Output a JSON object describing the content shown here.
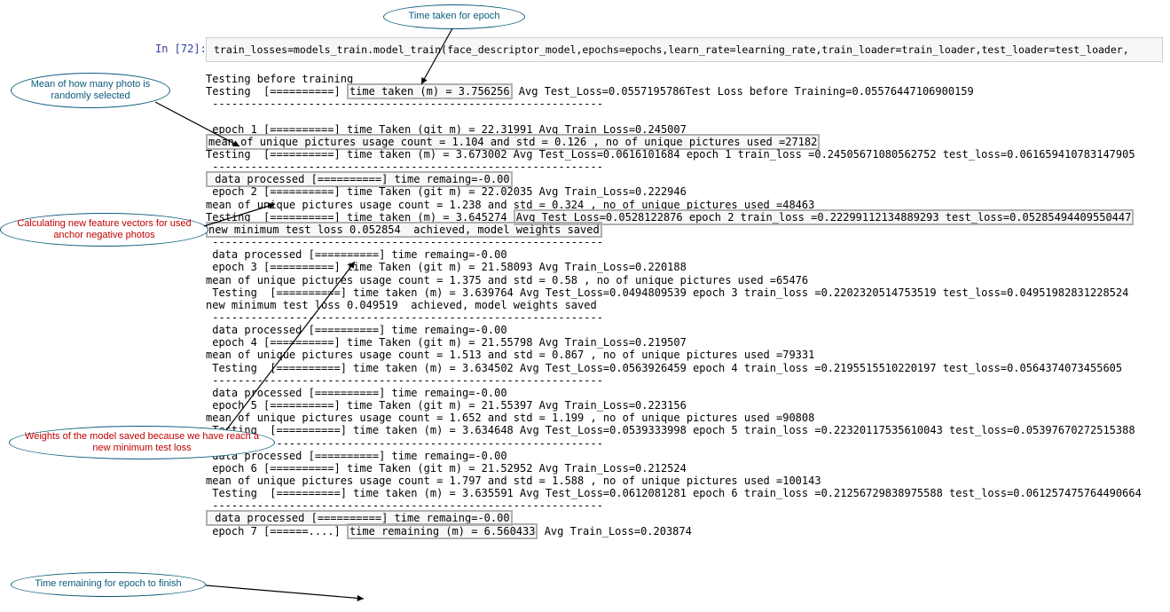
{
  "prompt": "In [72]:",
  "code": "train_losses=models_train.model_train(face_descriptor_model,epochs=epochs,learn_rate=learning_rate,train_loader=train_loader,test_loader=test_loader,",
  "annotations": {
    "bubble1": "Time taken for epoch",
    "bubble2": "Mean of how many photo is randomly selected",
    "bubble3": "Calculating new feature vectors for used anchor negative photos",
    "bubble4": "Weights of the model saved because we have reach a new minimum test loss",
    "bubble5": "Time remaining for epoch to finish"
  },
  "output": {
    "l01": "Testing before training",
    "l02a": "Testing  [==========] ",
    "l02b": "time taken (m) = 3.756256",
    "l02c": " Avg Test_Loss=0.0557195786Test Loss before Training=0.05576447106900159",
    "l03": " -------------------------------------------------------------",
    "bl": "",
    "l05": " epoch 1 [==========] time Taken (git m) = 22.31991 Avg Train_Loss=0.245007",
    "l06a": "mean of unique pictures usage count = 1.104 and std = 0.126 , no of unique pictures used =27182",
    "l07": "Testing  [==========] time taken (m) = 3.673002 Avg Test_Loss=0.0616101684 epoch 1 train_loss =0.24505671080562752 test_loss=0.061659410783147905",
    "l08": " -------------------------------------------------------------",
    "l09a": " data processed [==========] time remaing=-0.00",
    "l10": " epoch 2 [==========] time Taken (git m) = 22.02035 Avg Train_Loss=0.222946",
    "l11": "mean of unique pictures usage count = 1.238 and std = 0.324 , no of unique pictures used =48463",
    "l12a": "Testing  [==========] time taken (m) = 3.645274 ",
    "l12b": "Avg Test_Loss=0.0528122876 epoch 2 train_loss =0.22299112134889293 test_loss=0.05285494409550447",
    "l13a": "new minimum test loss 0.052854  achieved, model weights saved",
    "l14": " -------------------------------------------------------------",
    "l15": " data processed [==========] time remaing=-0.00",
    "l16": " epoch 3 [==========] time Taken (git m) = 21.58093 Avg Train_Loss=0.220188",
    "l17": "mean of unique pictures usage count = 1.375 and std = 0.58 , no of unique pictures used =65476",
    "l18": " Testing  [==========] time taken (m) = 3.639764 Avg Test_Loss=0.0494809539 epoch 3 train_loss =0.2202320514753519 test_loss=0.04951982831228524",
    "l19": "new minimum test loss 0.049519  achieved, model weights saved",
    "l20": " -------------------------------------------------------------",
    "l21": " data processed [==========] time remaing=-0.00",
    "l22": " epoch 4 [==========] time Taken (git m) = 21.55798 Avg Train_Loss=0.219507",
    "l23": "mean of unique pictures usage count = 1.513 and std = 0.867 , no of unique pictures used =79331",
    "l24": " Testing  [==========] time taken (m) = 3.634502 Avg Test_Loss=0.0563926459 epoch 4 train_loss =0.2195515510220197 test_loss=0.0564374073455605",
    "l25": " -------------------------------------------------------------",
    "l26": " data processed [==========] time remaing=-0.00",
    "l27": " epoch 5 [==========] time Taken (git m) = 21.55397 Avg Train_Loss=0.223156",
    "l28": "mean of unique pictures usage count = 1.652 and std = 1.199 , no of unique pictures used =90808",
    "l29": " Testing  [==========] time taken (m) = 3.634648 Avg Test_Loss=0.0539333998 epoch 5 train_loss =0.22320117535610043 test_loss=0.05397670272515388",
    "l30": " -------------------------------------------------------------",
    "l31": " data processed [==========] time remaing=-0.00",
    "l32": " epoch 6 [==========] time Taken (git m) = 21.52952 Avg Train_Loss=0.212524",
    "l33": "mean of unique pictures usage count = 1.797 and std = 1.588 , no of unique pictures used =100143",
    "l34": " Testing  [==========] time taken (m) = 3.635591 Avg Test_Loss=0.0612081281 epoch 6 train_loss =0.21256729838975588 test_loss=0.061257475764490664",
    "l35": " -------------------------------------------------------------",
    "l36a": " data processed [==========] time remaing=-0.00",
    "l37a": " epoch 7 [======....] ",
    "l37b": "time remaining (m) = 6.560433",
    "l37c": " Avg Train_Loss=0.203874"
  }
}
